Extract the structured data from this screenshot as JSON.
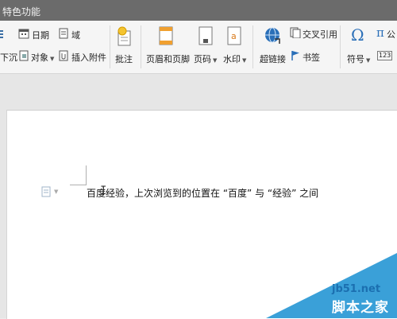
{
  "titlebar": {
    "tab_label": "特色功能"
  },
  "ribbon": {
    "date_label": "日期",
    "field_label": "域",
    "dropcap_partial_label": "下沉",
    "object_label": "对象",
    "attachment_label": "插入附件",
    "comment_label": "批注",
    "header_footer_label": "页眉和页脚",
    "page_number_label": "页码",
    "watermark_label": "水印",
    "hyperlink_label": "超链接",
    "cross_reference_label": "交叉引用",
    "bookmark_label": "书签",
    "symbol_label": "符号",
    "formula_partial_label": "公",
    "numbering_icon_text": "123"
  },
  "document": {
    "paragraph_text": "百度经验，上次浏览到的位置在 “百度” 与 “经验” 之间"
  },
  "watermark": {
    "site": "jb51.net",
    "name": "脚本之家"
  },
  "colors": {
    "titlebar": "#6b6b6b",
    "ribbon_bg": "#f5f5f5",
    "watermark_bg": "#3aa0d8",
    "accent_blue": "#2a6fb8"
  }
}
